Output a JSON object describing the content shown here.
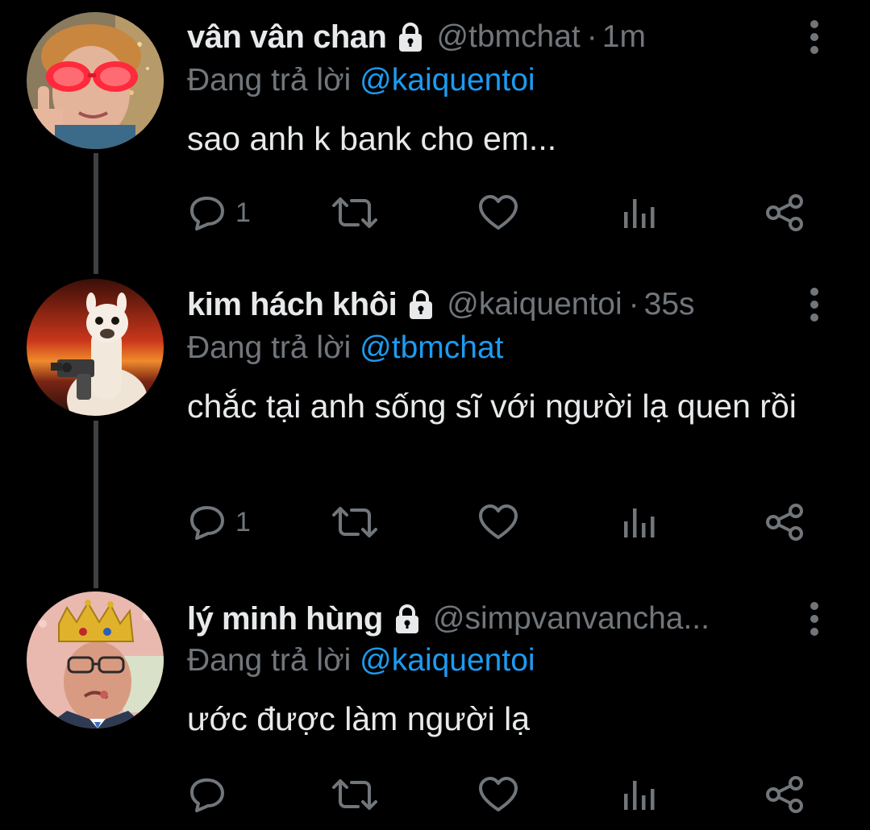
{
  "thread": {
    "reply_prefix": "Đang trả lời",
    "tweets": [
      {
        "name": "vân vân chan",
        "handle": "@tbmchat",
        "separator": "·",
        "time": "1m",
        "reply_to": "@kaiquentoi",
        "text": "sao anh k bank cho em...",
        "reply_count": "1",
        "avatar": "avatar-woman-red-glasses",
        "locked": true
      },
      {
        "name": "kim hách khôi",
        "handle": "@kaiquentoi",
        "separator": "·",
        "time": "35s",
        "reply_to": "@tbmchat",
        "text": "chắc tại anh sống sĩ với người lạ quen rồi",
        "reply_count": "1",
        "avatar": "avatar-llama-gun",
        "locked": true
      },
      {
        "name": "lý minh hùng",
        "handle": "@simpvanvancha...",
        "separator": "",
        "time": "",
        "reply_to": "@kaiquentoi",
        "text": "ước được làm người lạ",
        "reply_count": "",
        "avatar": "avatar-man-crown",
        "locked": true
      }
    ]
  },
  "icons": {
    "lock": "lock-icon",
    "more": "more-vertical-icon",
    "reply": "reply-bubble-icon",
    "retweet": "retweet-icon",
    "like": "heart-icon",
    "views": "views-bar-chart-icon",
    "share": "share-icon"
  },
  "colors": {
    "background": "#000000",
    "primary_text": "#e7e9ea",
    "secondary_text": "#71767b",
    "link": "#1d9bf0",
    "thread_line": "#3e4144"
  }
}
